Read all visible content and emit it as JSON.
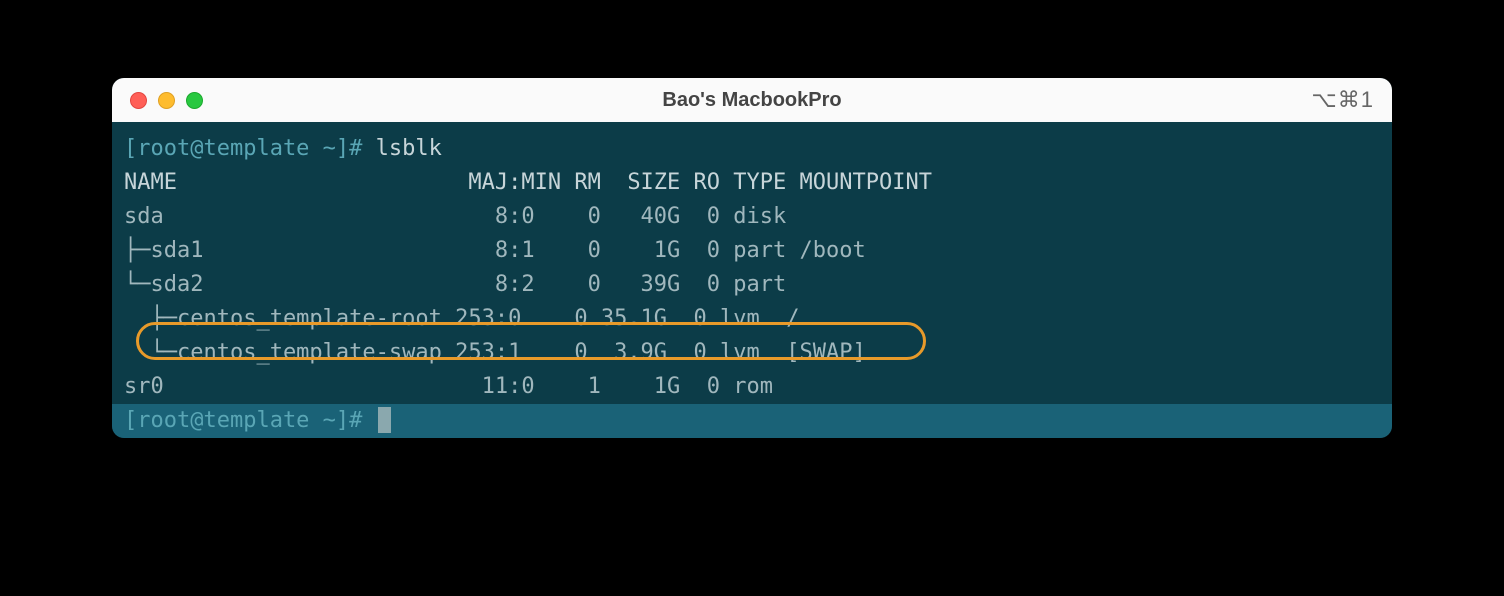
{
  "window": {
    "title": "Bao's MacbookPro",
    "shortcut": "⌥⌘1"
  },
  "prompt": {
    "user_host": "[root@template ~]#",
    "command": "lsblk"
  },
  "header": "NAME                      MAJ:MIN RM  SIZE RO TYPE MOUNTPOINT",
  "rows": [
    "sda                         8:0    0   40G  0 disk ",
    "├─sda1                      8:1    0    1G  0 part /boot",
    "└─sda2                      8:2    0   39G  0 part ",
    "  ├─centos_template-root 253:0    0 35.1G  0 lvm  /",
    "  └─centos_template-swap 253:1    0  3.9G  0 lvm  [SWAP]",
    "sr0                        11:0    1    1G  0 rom  "
  ],
  "prompt2": "[root@template ~]#"
}
